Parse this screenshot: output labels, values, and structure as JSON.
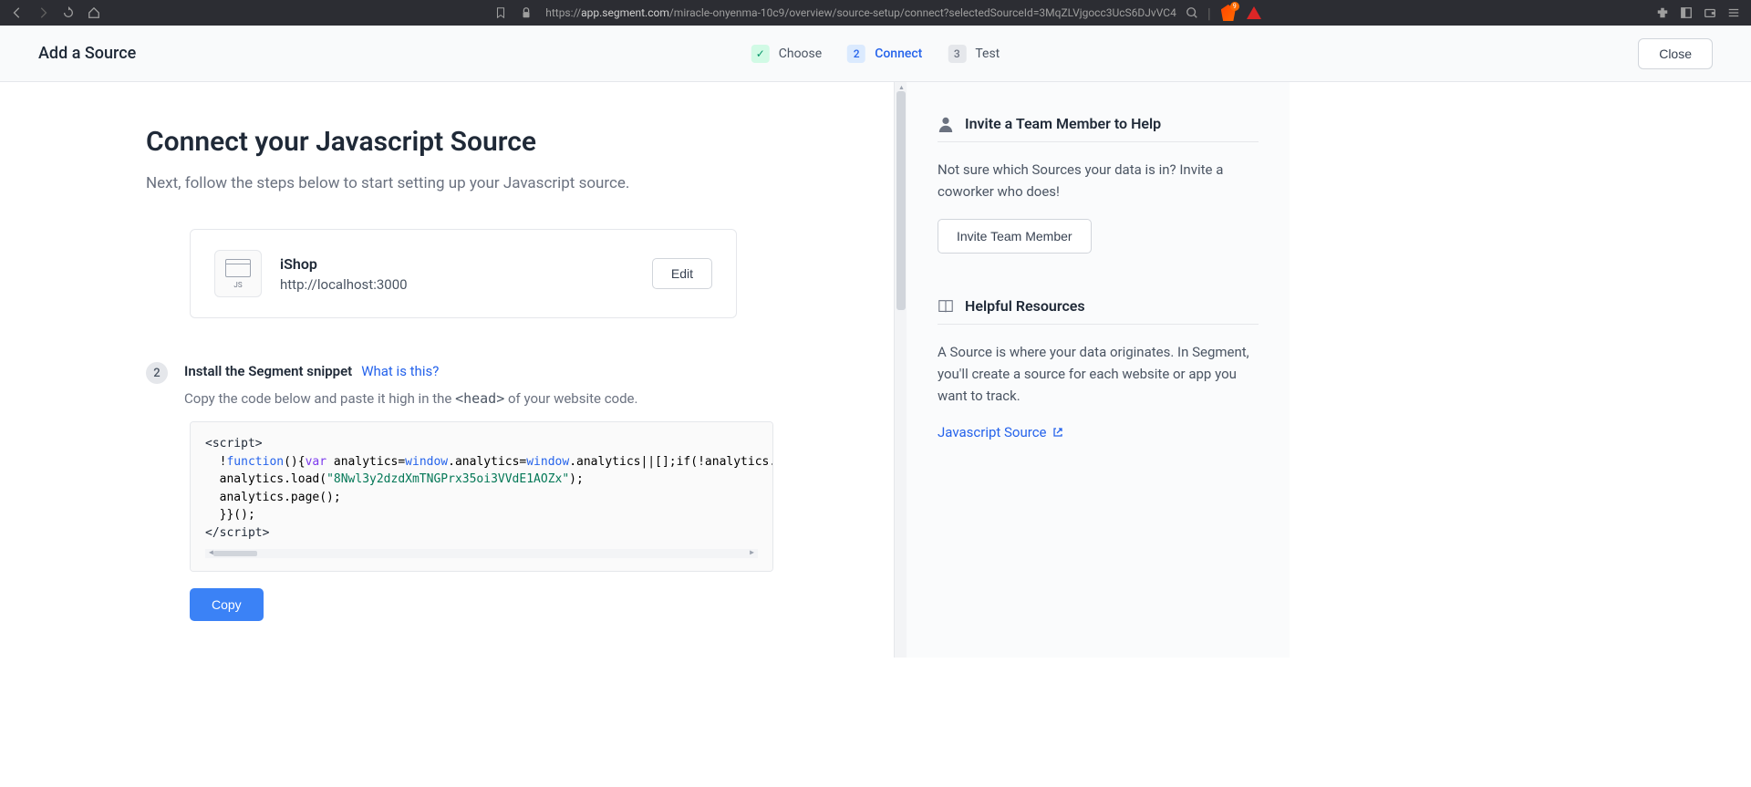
{
  "browser": {
    "url_prefix": "https://",
    "url_domain": "app.segment.com",
    "url_path": "/miracle-onyenma-10c9/overview/source-setup/connect?selectedSourceId=3MqZLVjgocc3UcS6DJvVC4",
    "badge": "9"
  },
  "header": {
    "title": "Add a Source",
    "steps": [
      {
        "icon": "✓",
        "label": "Choose",
        "state": "done"
      },
      {
        "icon": "2",
        "label": "Connect",
        "state": "active"
      },
      {
        "icon": "3",
        "label": "Test",
        "state": "pending"
      }
    ],
    "close": "Close"
  },
  "page": {
    "title": "Connect your Javascript Source",
    "subtitle": "Next, follow the steps below to start setting up your Javascript source."
  },
  "source": {
    "icon_label": "JS",
    "name": "iShop",
    "url": "http://localhost:3000",
    "edit": "Edit"
  },
  "install": {
    "step_num": "2",
    "title": "Install the Segment snippet",
    "what_link": "What is this?",
    "desc_before": "Copy the code below and paste it high in the ",
    "desc_code": "<head>",
    "desc_after": " of your website code.",
    "code_key": "8Nwl3y2dzdXmTNGPrx35oi3VVdE1AOZx",
    "copy": "Copy"
  },
  "sidebar": {
    "invite": {
      "title": "Invite a Team Member to Help",
      "text": "Not sure which Sources your data is in? Invite a coworker who does!",
      "button": "Invite Team Member"
    },
    "resources": {
      "title": "Helpful Resources",
      "text": "A Source is where your data originates. In Segment, you'll create a source for each website or app you want to track.",
      "link": "Javascript Source"
    }
  }
}
